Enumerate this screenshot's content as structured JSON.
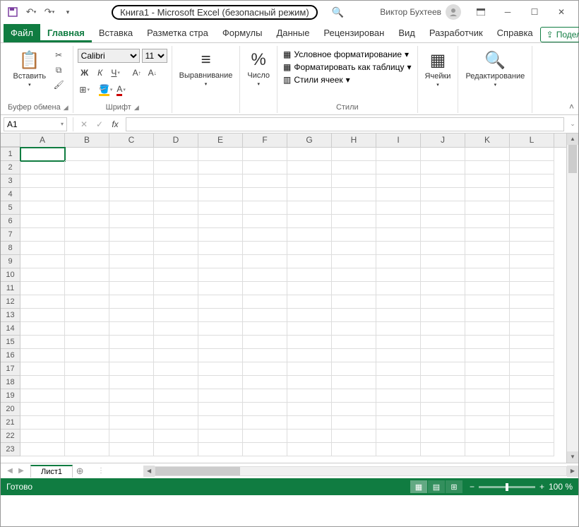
{
  "title": "Книга1  -  Microsoft Excel (безопасный режим)",
  "user_name": "Виктор Бухтеев",
  "tabs": {
    "file": "Файл",
    "home": "Главная",
    "insert": "Вставка",
    "layout": "Разметка стра",
    "formulas": "Формулы",
    "data": "Данные",
    "review": "Рецензирован",
    "view": "Вид",
    "developer": "Разработчик",
    "help": "Справка"
  },
  "share": "Поделиться",
  "ribbon": {
    "paste": "Вставить",
    "clipboard_label": "Буфер обмена",
    "font_name": "Calibri",
    "font_size": "11",
    "font_label": "Шрифт",
    "alignment": "Выравнивание",
    "number": "Число",
    "cond_format": "Условное форматирование",
    "format_table": "Форматировать как таблицу",
    "cell_styles": "Стили ячеек",
    "styles_label": "Стили",
    "cells": "Ячейки",
    "editing": "Редактирование"
  },
  "namebox": "A1",
  "columns": [
    "A",
    "B",
    "C",
    "D",
    "E",
    "F",
    "G",
    "H",
    "I",
    "J",
    "K",
    "L"
  ],
  "rows": [
    1,
    2,
    3,
    4,
    5,
    6,
    7,
    8,
    9,
    10,
    11,
    12,
    13,
    14,
    15,
    16,
    17,
    18,
    19,
    20,
    21,
    22,
    23
  ],
  "sheet": "Лист1",
  "status": "Готово",
  "zoom": "100 %"
}
